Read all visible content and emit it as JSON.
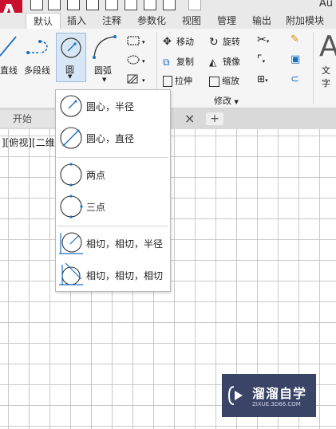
{
  "app": {
    "logo": "A",
    "title_fragment": "Au"
  },
  "ribbon_tabs": [
    "默认",
    "插入",
    "注释",
    "参数化",
    "视图",
    "管理",
    "输出",
    "附加模块"
  ],
  "active_tab": "默认",
  "draw_panel": {
    "line_label": "直线",
    "polyline_label": "多段线",
    "circle_label": "圆",
    "arc_label": "圆弧"
  },
  "modify_panel": {
    "move": "移动",
    "rotate": "旋转",
    "copy": "复制",
    "mirror": "镜像",
    "stretch": "拉伸",
    "scale": "缩放",
    "label": "修改"
  },
  "text_panel": {
    "letter": "A",
    "label": "文字"
  },
  "doc_tabs": {
    "start": "开始",
    "close": "×",
    "add": "+"
  },
  "viewport_label": "][俯视][二维",
  "circle_menu": [
    {
      "label": "圆心，半径",
      "icon": "circle-center-radius-icon"
    },
    {
      "label": "圆心，直径",
      "icon": "circle-center-diameter-icon"
    },
    {
      "label": "两点",
      "icon": "circle-two-point-icon"
    },
    {
      "label": "三点",
      "icon": "circle-three-point-icon"
    },
    {
      "label": "相切，相切，半径",
      "icon": "circle-tan-tan-radius-icon"
    },
    {
      "label": "相切，相切，相切",
      "icon": "circle-tan-tan-tan-icon"
    }
  ],
  "watermark": {
    "title": "溜溜自学",
    "subtitle": "ZIXUE.3D66.COM"
  },
  "colors": {
    "accent_blue": "#1a6fc4",
    "logo_red": "#c8102e",
    "watermark_bg": "#3a4466"
  }
}
